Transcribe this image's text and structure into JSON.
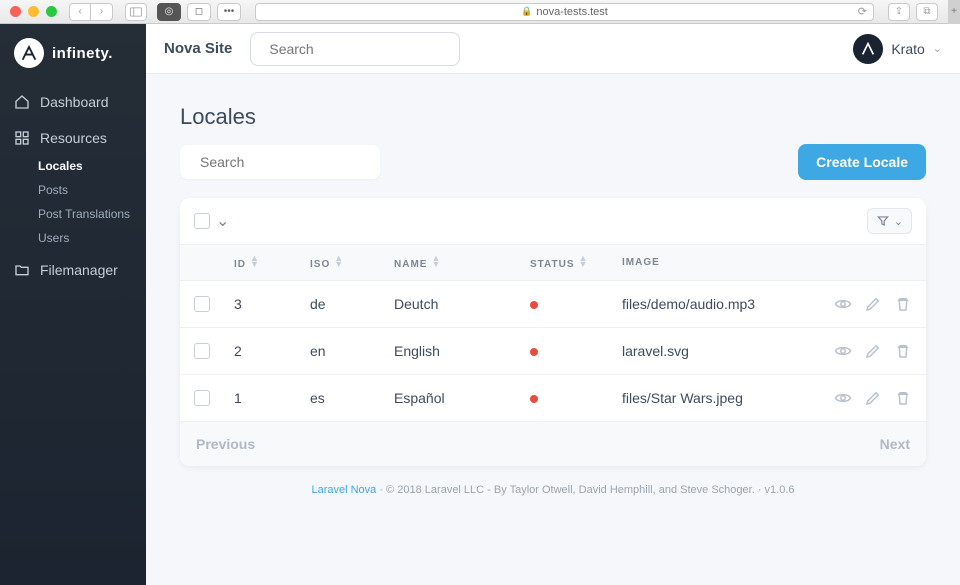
{
  "browser": {
    "url": "nova-tests.test"
  },
  "brand": {
    "name": "infinety."
  },
  "topbar": {
    "site_name": "Nova Site",
    "search_placeholder": "Search",
    "user_name": "Krato"
  },
  "sidebar": {
    "items": [
      {
        "label": "Dashboard"
      },
      {
        "label": "Resources"
      },
      {
        "label": "Filemanager"
      }
    ],
    "resources": [
      {
        "label": "Locales",
        "active": true
      },
      {
        "label": "Posts"
      },
      {
        "label": "Post Translations"
      },
      {
        "label": "Users"
      }
    ]
  },
  "page": {
    "title": "Locales",
    "search_placeholder": "Search",
    "create_label": "Create Locale"
  },
  "table": {
    "headers": {
      "id": "ID",
      "iso": "ISO",
      "name": "NAME",
      "status": "STATUS",
      "image": "IMAGE"
    },
    "rows": [
      {
        "id": "3",
        "iso": "de",
        "name": "Deutch",
        "status": "red",
        "image": "files/demo/audio.mp3"
      },
      {
        "id": "2",
        "iso": "en",
        "name": "English",
        "status": "red",
        "image": "laravel.svg"
      },
      {
        "id": "1",
        "iso": "es",
        "name": "Español",
        "status": "red",
        "image": "files/Star Wars.jpeg"
      }
    ],
    "pagination": {
      "prev": "Previous",
      "next": "Next"
    }
  },
  "footer": {
    "link": "Laravel Nova",
    "copyright": "© 2018 Laravel LLC - By Taylor Otwell, David Hemphill, and Steve Schoger.",
    "version": "v1.0.6"
  }
}
